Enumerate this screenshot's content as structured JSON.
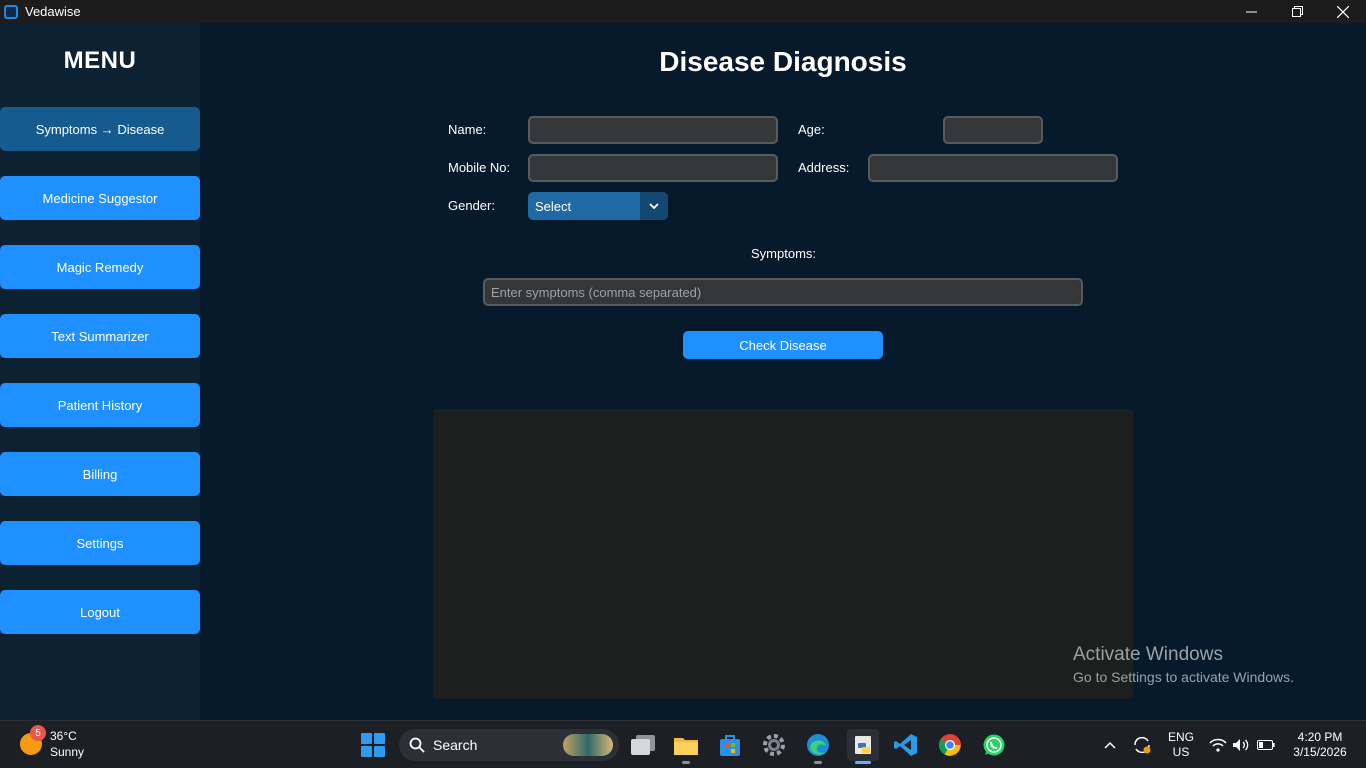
{
  "window": {
    "title": "Vedawise"
  },
  "sidebar": {
    "title": "MENU",
    "items": [
      {
        "label": "Symptoms → Disease"
      },
      {
        "label": "Medicine Suggestor"
      },
      {
        "label": "Magic Remedy"
      },
      {
        "label": "Text Summarizer"
      },
      {
        "label": "Patient History"
      },
      {
        "label": "Billing"
      },
      {
        "label": "Settings"
      },
      {
        "label": "Logout"
      }
    ]
  },
  "form": {
    "title": "Disease Diagnosis",
    "name_label": "Name:",
    "name_value": "",
    "age_label": "Age:",
    "age_value": "",
    "mobile_label": "Mobile No:",
    "mobile_value": "",
    "address_label": "Address:",
    "address_value": "",
    "gender_label": "Gender:",
    "gender_selected": "Select",
    "symptoms_label": "Symptoms:",
    "symptoms_placeholder": "Enter symptoms (comma separated)",
    "check_button": "Check Disease"
  },
  "watermark": {
    "line1": "Activate Windows",
    "line2": "Go to Settings to activate Windows."
  },
  "taskbar": {
    "weather_badge": "5",
    "weather_temp": "36°C",
    "weather_desc": "Sunny",
    "search_label": "Search",
    "lang_line1": "ENG",
    "lang_line2": "US",
    "time": "4:20 PM",
    "date": "3/15/2026",
    "icons": [
      "file-explorer-icon",
      "store-icon",
      "settings-icon",
      "edge-icon",
      "python-icon",
      "vscode-icon",
      "chrome-icon",
      "whatsapp-icon"
    ]
  },
  "colors": {
    "background": "#061a2c",
    "sidebar": "#0c2233",
    "accent": "#1e90ff",
    "active": "#155b8f"
  }
}
